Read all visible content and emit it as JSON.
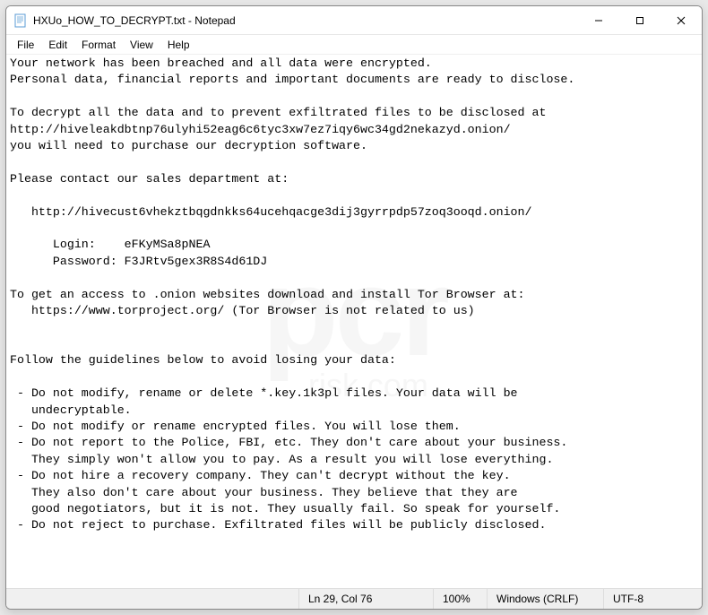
{
  "window": {
    "title": "HXUo_HOW_TO_DECRYPT.txt - Notepad"
  },
  "menubar": {
    "file": "File",
    "edit": "Edit",
    "format": "Format",
    "view": "View",
    "help": "Help"
  },
  "content": {
    "text": "Your network has been breached and all data were encrypted.\nPersonal data, financial reports and important documents are ready to disclose.\n\nTo decrypt all the data and to prevent exfiltrated files to be disclosed at \nhttp://hiveleakdbtnp76ulyhi52eag6c6tyc3xw7ez7iqy6wc34gd2nekazyd.onion/\nyou will need to purchase our decryption software.\n\nPlease contact our sales department at:\n\n   http://hivecust6vhekztbqgdnkks64ucehqacge3dij3gyrrpdp57zoq3ooqd.onion/\n\n      Login:    eFKyMSa8pNEA\n      Password: F3JRtv5gex3R8S4d61DJ\n\nTo get an access to .onion websites download and install Tor Browser at:\n   https://www.torproject.org/ (Tor Browser is not related to us)\n\n\nFollow the guidelines below to avoid losing your data:\n\n - Do not modify, rename or delete *.key.1k3pl files. Your data will be \n   undecryptable.\n - Do not modify or rename encrypted files. You will lose them.\n - Do not report to the Police, FBI, etc. They don't care about your business.\n   They simply won't allow you to pay. As a result you will lose everything.\n - Do not hire a recovery company. They can't decrypt without the key.\n   They also don't care about your business. They believe that they are \n   good negotiators, but it is not. They usually fail. So speak for yourself.\n - Do not reject to purchase. Exfiltrated files will be publicly disclosed."
  },
  "statusbar": {
    "position": "Ln 29, Col 76",
    "zoom": "100%",
    "line_ending": "Windows (CRLF)",
    "encoding": "UTF-8"
  },
  "watermark": {
    "main": "pcr",
    "sub": "risk.com"
  }
}
